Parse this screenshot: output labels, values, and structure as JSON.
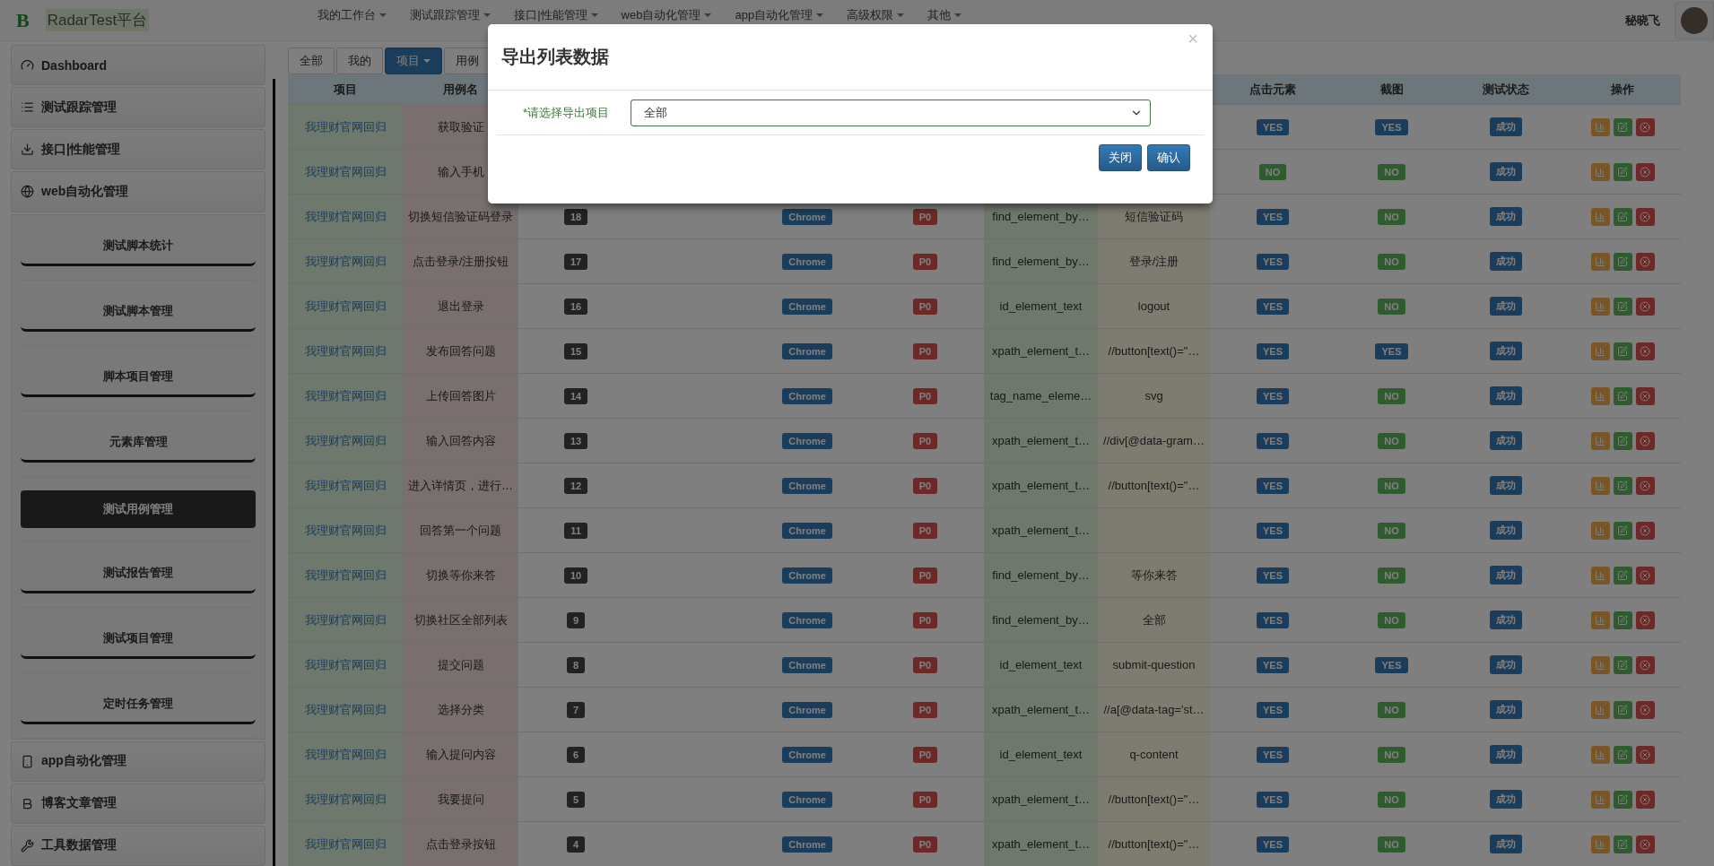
{
  "navbar": {
    "logo": "B",
    "brand": "RadarTest平台",
    "menus": [
      "我的工作台",
      "测试跟踪管理",
      "接口|性能管理",
      "web自动化管理",
      "app自动化管理",
      "高级权限",
      "其他"
    ],
    "user": "秘晓飞"
  },
  "sidebar": {
    "items": [
      {
        "label": "Dashboard"
      },
      {
        "label": "测试跟踪管理"
      },
      {
        "label": "接口|性能管理"
      },
      {
        "label": "web自动化管理",
        "children": [
          {
            "label": "测试脚本统计",
            "selected": false
          },
          {
            "label": "测试脚本管理",
            "selected": false
          },
          {
            "label": "脚本项目管理",
            "selected": false
          },
          {
            "label": "元素库管理",
            "selected": false
          },
          {
            "label": "测试用例管理",
            "selected": true
          },
          {
            "label": "测试报告管理",
            "selected": false
          },
          {
            "label": "测试项目管理",
            "selected": false
          },
          {
            "label": "定时任务管理",
            "selected": false
          }
        ]
      },
      {
        "label": "app自动化管理"
      },
      {
        "label": "博客文章管理"
      },
      {
        "label": "工具数据管理"
      }
    ]
  },
  "tabs": [
    {
      "label": "全部",
      "selected": false
    },
    {
      "label": "我的",
      "selected": false
    },
    {
      "label": "项目",
      "selected": true,
      "dropdown": true
    },
    {
      "label": "用例",
      "selected": false
    }
  ],
  "table": {
    "columns": [
      "项目",
      "用例名",
      "",
      "",
      "",
      "",
      "",
      "",
      "点击元素",
      "截图",
      "测试状态",
      "操作"
    ],
    "rows": [
      {
        "project": "我理财官网回归",
        "name": "获取验证",
        "click": {
          "label": "YES",
          "on": true
        },
        "shot": {
          "label": "YES",
          "on": true
        },
        "status": "成功"
      },
      {
        "project": "我理财官网回归",
        "name": "输入手机",
        "click": {
          "label": "NO",
          "on": false
        },
        "shot": {
          "label": "NO",
          "on": false
        },
        "status": "成功"
      },
      {
        "project": "我理财官网回归",
        "name": "切换短信验证码登录",
        "order": "18",
        "browser": "Chrome",
        "level": "P0",
        "locator": "find_element_by…",
        "element": "短信验证码",
        "click": {
          "label": "YES",
          "on": true
        },
        "shot": {
          "label": "NO",
          "on": false
        },
        "status": "成功"
      },
      {
        "project": "我理财官网回归",
        "name": "点击登录/注册按钮",
        "order": "17",
        "browser": "Chrome",
        "level": "P0",
        "locator": "find_element_by…",
        "element": "登录/注册",
        "click": {
          "label": "YES",
          "on": true
        },
        "shot": {
          "label": "NO",
          "on": false
        },
        "status": "成功"
      },
      {
        "project": "我理财官网回归",
        "name": "退出登录",
        "order": "16",
        "browser": "Chrome",
        "level": "P0",
        "locator": "id_element_text",
        "element": "logout",
        "click": {
          "label": "YES",
          "on": true
        },
        "shot": {
          "label": "NO",
          "on": false
        },
        "status": "成功"
      },
      {
        "project": "我理财官网回归",
        "name": "发布回答问题",
        "order": "15",
        "browser": "Chrome",
        "level": "P0",
        "locator": "xpath_element_t…",
        "element": "//button[text()=\"…",
        "click": {
          "label": "YES",
          "on": true
        },
        "shot": {
          "label": "YES",
          "on": true
        },
        "status": "成功"
      },
      {
        "project": "我理财官网回归",
        "name": "上传回答图片",
        "order": "14",
        "browser": "Chrome",
        "level": "P0",
        "locator": "tag_name_eleme…",
        "element": "svg",
        "click": {
          "label": "YES",
          "on": true
        },
        "shot": {
          "label": "NO",
          "on": false
        },
        "status": "成功"
      },
      {
        "project": "我理财官网回归",
        "name": "输入回答内容",
        "order": "13",
        "browser": "Chrome",
        "level": "P0",
        "locator": "xpath_element_t…",
        "element": "//div[@data-gram…",
        "click": {
          "label": "YES",
          "on": true
        },
        "shot": {
          "label": "NO",
          "on": false
        },
        "status": "成功"
      },
      {
        "project": "我理财官网回归",
        "name": "进入详情页，进行…",
        "order": "12",
        "browser": "Chrome",
        "level": "P0",
        "locator": "xpath_element_t…",
        "element": "//button[text()=\"…",
        "click": {
          "label": "YES",
          "on": true
        },
        "shot": {
          "label": "NO",
          "on": false
        },
        "status": "成功"
      },
      {
        "project": "我理财官网回归",
        "name": "回答第一个问题",
        "order": "11",
        "browser": "Chrome",
        "level": "P0",
        "locator": "xpath_element_t…",
        "click": {
          "label": "YES",
          "on": true
        },
        "shot": {
          "label": "NO",
          "on": false
        },
        "status": "成功"
      },
      {
        "project": "我理财官网回归",
        "name": "切换等你来答",
        "order": "10",
        "browser": "Chrome",
        "level": "P0",
        "locator": "find_element_by…",
        "element": "等你来答",
        "click": {
          "label": "YES",
          "on": true
        },
        "shot": {
          "label": "NO",
          "on": false
        },
        "status": "成功"
      },
      {
        "project": "我理财官网回归",
        "name": "切换社区全部列表",
        "order": "9",
        "browser": "Chrome",
        "level": "P0",
        "locator": "find_element_by…",
        "element": "全部",
        "click": {
          "label": "YES",
          "on": true
        },
        "shot": {
          "label": "NO",
          "on": false
        },
        "status": "成功"
      },
      {
        "project": "我理财官网回归",
        "name": "提交问题",
        "order": "8",
        "browser": "Chrome",
        "level": "P0",
        "locator": "id_element_text",
        "element": "submit-question",
        "click": {
          "label": "YES",
          "on": true
        },
        "shot": {
          "label": "YES",
          "on": true
        },
        "status": "成功"
      },
      {
        "project": "我理财官网回归",
        "name": "选择分类",
        "order": "7",
        "browser": "Chrome",
        "level": "P0",
        "locator": "xpath_element_t…",
        "element": "//a[@data-tag='st…",
        "click": {
          "label": "YES",
          "on": true
        },
        "shot": {
          "label": "NO",
          "on": false
        },
        "status": "成功"
      },
      {
        "project": "我理财官网回归",
        "name": "输入提问内容",
        "order": "6",
        "browser": "Chrome",
        "level": "P0",
        "locator": "id_element_text",
        "element": "q-content",
        "click": {
          "label": "YES",
          "on": true
        },
        "shot": {
          "label": "NO",
          "on": false
        },
        "status": "成功"
      },
      {
        "project": "我理财官网回归",
        "name": "我要提问",
        "order": "5",
        "browser": "Chrome",
        "level": "P0",
        "locator": "xpath_element_t…",
        "element": "//button[text()=\"…",
        "click": {
          "label": "YES",
          "on": true
        },
        "shot": {
          "label": "NO",
          "on": false
        },
        "status": "成功"
      },
      {
        "project": "我理财官网回归",
        "name": "点击登录按钮",
        "order": "4",
        "browser": "Chrome",
        "level": "P0",
        "locator": "xpath_element_t…",
        "element": "//button[text()=\"…",
        "click": {
          "label": "YES",
          "on": true
        },
        "shot": {
          "label": "NO",
          "on": false
        },
        "status": "成功"
      }
    ]
  },
  "modal": {
    "title": "导出列表数据",
    "close": "×",
    "label": "*请选择导出项目",
    "select_value": "全部",
    "buttons": [
      "关闭",
      "确认"
    ]
  }
}
